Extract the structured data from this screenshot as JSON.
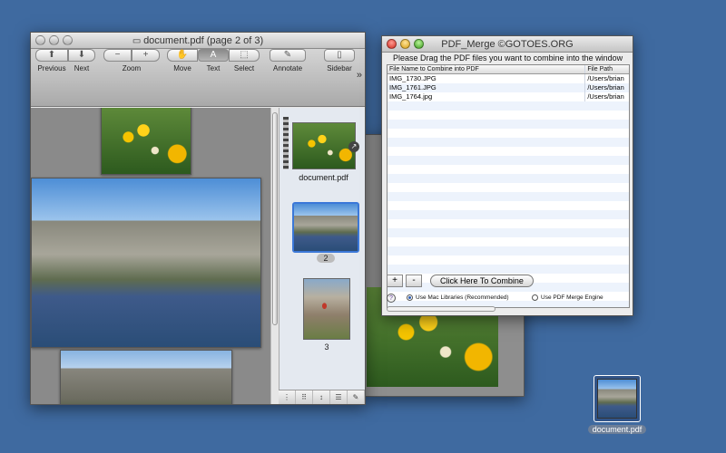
{
  "preview": {
    "title": "document.pdf (page 2 of 3)",
    "toolbar": {
      "previous": "Previous",
      "next": "Next",
      "zoom": "Zoom",
      "move": "Move",
      "text": "Text",
      "select": "Select",
      "annotate": "Annotate",
      "sidebar": "Sidebar",
      "zoom_out_symbol": "−",
      "zoom_in_symbol": "+",
      "overflow_symbol": "»"
    },
    "sidebar": {
      "document_name": "document.pdf",
      "pages": [
        "2",
        "3"
      ]
    },
    "bottom_bar": [
      "⋮",
      "⠿",
      "↕",
      "☰",
      "✎"
    ]
  },
  "merge": {
    "title": "PDF_Merge ©GOTOES.ORG",
    "instruction": "Please Drag the PDF files you want to combine into the window",
    "columns": [
      "File Name to Combine into PDF",
      "File Path"
    ],
    "rows": [
      {
        "name": "IMG_1730.JPG",
        "path": "/Users/brian"
      },
      {
        "name": "IMG_1761.JPG",
        "path": "/Users/brian"
      },
      {
        "name": "IMG_1764.jpg",
        "path": "/Users/brian"
      }
    ],
    "add_label": "+",
    "remove_label": "-",
    "combine_label": "Click Here To Combine",
    "help_label": "?",
    "option_mac": "Use Mac Libraries (Recommended)",
    "option_engine": "Use PDF Merge Engine",
    "selected_option": "mac",
    "progress_fraction": 0.0
  },
  "desktop": {
    "file_name": "document.pdf"
  },
  "colors": {
    "desktop": "#3f6aa0",
    "selection": "#3b78d8"
  }
}
